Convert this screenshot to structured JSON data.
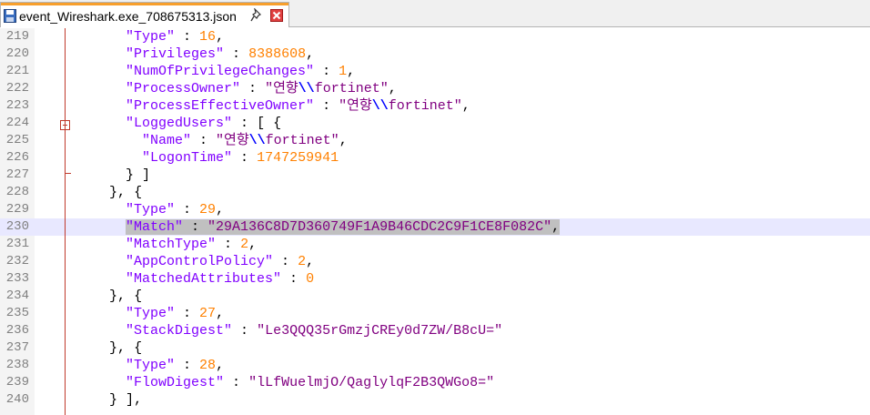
{
  "tab": {
    "title": "event_Wireshark.exe_708675313.json",
    "accent_color": "#f79f2c",
    "icons": [
      "save-icon",
      "pin-icon",
      "close-icon"
    ]
  },
  "editor": {
    "current_line": 230,
    "selection_text": "\"Match\" : \"29A136C8D7D360749F1A9B46CDC2C9F1CE8F082C\",",
    "lines": [
      {
        "num": "219",
        "text": "      \"Type\" : 16,"
      },
      {
        "num": "220",
        "text": "      \"Privileges\" : 8388608,"
      },
      {
        "num": "221",
        "text": "      \"NumOfPrivilegeChanges\" : 1,"
      },
      {
        "num": "222",
        "text": "      \"ProcessOwner\" : \"연향\\\\fortinet\","
      },
      {
        "num": "223",
        "text": "      \"ProcessEffectiveOwner\" : \"연향\\\\fortinet\","
      },
      {
        "num": "224",
        "text": "      \"LoggedUsers\" : [ {"
      },
      {
        "num": "225",
        "text": "        \"Name\" : \"연향\\\\fortinet\","
      },
      {
        "num": "226",
        "text": "        \"LogonTime\" : 1747259941"
      },
      {
        "num": "227",
        "text": "      } ]"
      },
      {
        "num": "228",
        "text": "    }, {"
      },
      {
        "num": "229",
        "text": "      \"Type\" : 29,"
      },
      {
        "num": "230",
        "text": "      \"Match\" : \"29A136C8D7D360749F1A9B46CDC2C9F1CE8F082C\","
      },
      {
        "num": "231",
        "text": "      \"MatchType\" : 2,"
      },
      {
        "num": "232",
        "text": "      \"AppControlPolicy\" : 2,"
      },
      {
        "num": "233",
        "text": "      \"MatchedAttributes\" : 0"
      },
      {
        "num": "234",
        "text": "    }, {"
      },
      {
        "num": "235",
        "text": "      \"Type\" : 27,"
      },
      {
        "num": "236",
        "text": "      \"StackDigest\" : \"Le3QQQ35rGmzjCREy0d7ZW/B8cU=\""
      },
      {
        "num": "237",
        "text": "    }, {"
      },
      {
        "num": "238",
        "text": "      \"Type\" : 28,"
      },
      {
        "num": "239",
        "text": "      \"FlowDigest\" : \"lLfWuelmjO/QaglylqF2B3QWGo8=\""
      },
      {
        "num": "240",
        "text": "    } ],"
      }
    ]
  }
}
